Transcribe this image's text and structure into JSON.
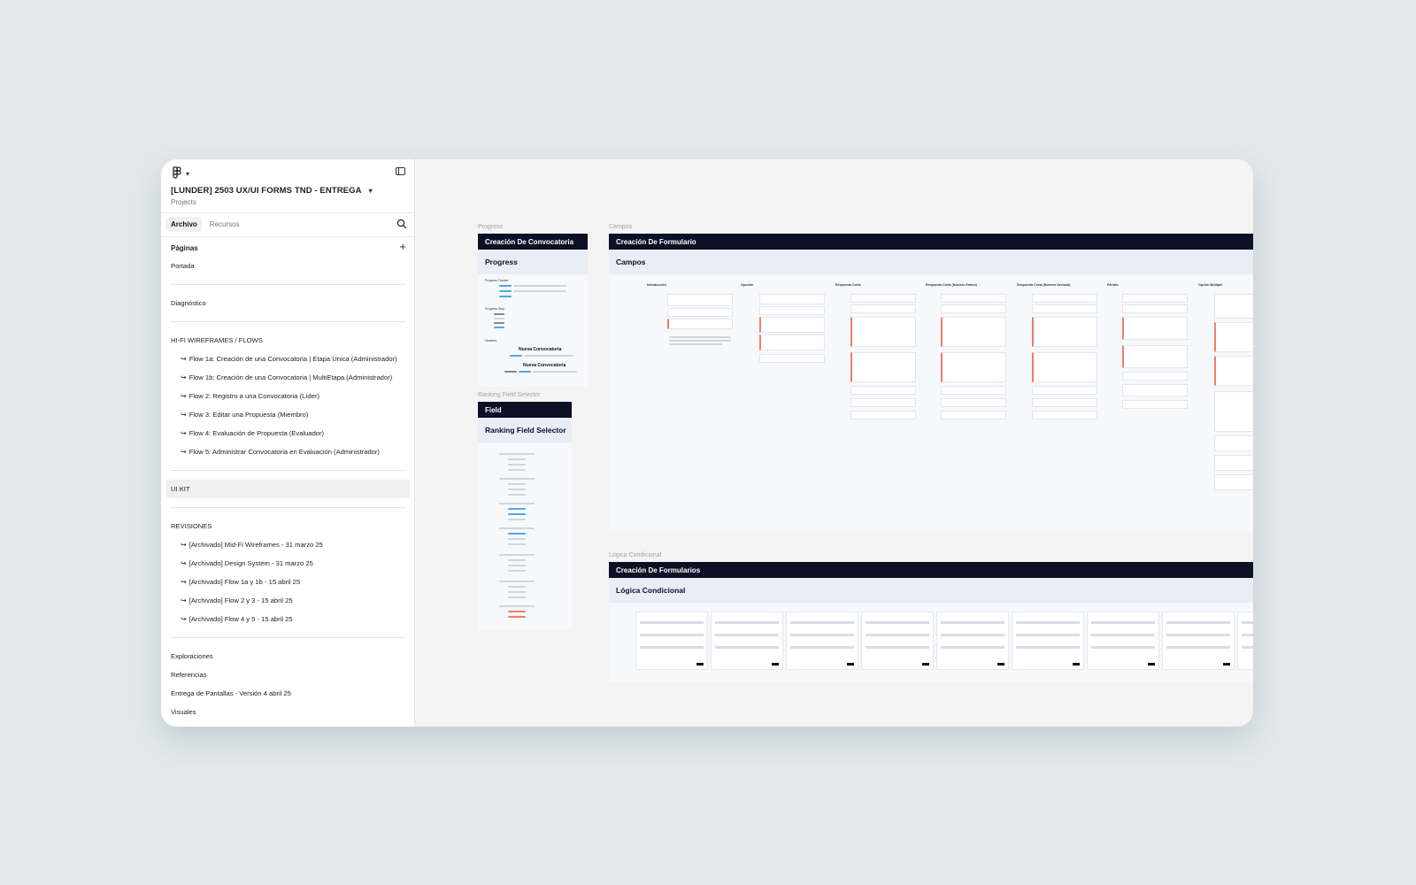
{
  "app": {
    "file_title": "[LUNDER] 2503 UX/UI FORMS TND - ENTREGA",
    "project": "Projects"
  },
  "tabs": [
    {
      "label": "Archivo",
      "active": true
    },
    {
      "label": "Recursos",
      "active": false
    }
  ],
  "pages_heading": "Páginas",
  "pages": [
    {
      "label": "Portada"
    },
    {
      "label": "Diagnóstico"
    },
    {
      "label": "HI-FI WIREFRAMES / FLOWS"
    },
    {
      "label": "Flow 1a: Creación de una Convocatoria | Etapa Única (Administrador)"
    },
    {
      "label": "Flow 1b: Creación de una Convocatoria  | MultiEtapa (Administrador)"
    },
    {
      "label": "Flow 2: Registro a una Convocatoria (Líder)"
    },
    {
      "label": "Flow 3: Editar una Propuesta (Miembro)"
    },
    {
      "label": "Flow 4: Evaluación de Propuesta (Evaluador)"
    },
    {
      "label": "Flow 5: Administrar Convocatoria en Evaluación (Administrador)"
    },
    {
      "label": "UI KIT"
    },
    {
      "label": "REVISIONES"
    },
    {
      "label": "[Archivado] Mid-Fi Wireframes - 31 marzo 25"
    },
    {
      "label": "[Archivado] Design System - 31 marzo 25"
    },
    {
      "label": "[Archivado] Flow 1a y 1b - 15 abril 25"
    },
    {
      "label": "[Archivado] Flow 2 y 3 - 15 abril 25"
    },
    {
      "label": "[Archivado] Flow 4 y 5 - 15 abril 25"
    },
    {
      "label": "Exploraciones"
    },
    {
      "label": "Referencias"
    },
    {
      "label": "Entrega de Pantallas - Versión 4 abril 25"
    },
    {
      "label": "Visuales"
    }
  ],
  "canvas": {
    "progress": {
      "label": "Progress",
      "header": "Creación De Convocatoria",
      "title": "Progress",
      "items": [
        "Progress Tracker",
        "Progress Step",
        "Headers",
        "Nueva Convocatoria",
        "Nueva Convocatoria"
      ]
    },
    "ranking": {
      "label": "Ranking Field Selector",
      "header": "Field",
      "title": "Ranking Field Selector"
    },
    "campos": {
      "label": "Campos",
      "header": "Creación De Formulario",
      "title": "Campos",
      "columns": [
        "Introducción",
        "Opcción",
        "Respuesta Corta",
        "Respuesta Corta (Número Entero)",
        "Respuesta Corta (Número Decimal)",
        "Párrafo",
        "Opción Múltiple"
      ]
    },
    "logica": {
      "label": "Lógica Condicional",
      "header": "Creación De Formularios",
      "title": "Lógica Condicional"
    }
  },
  "colors": {
    "frame_header": "#0b1025",
    "frame_sub": "#e8edf6",
    "accent_red": "#f07e6a",
    "accent_blue": "#4aa8e8"
  }
}
